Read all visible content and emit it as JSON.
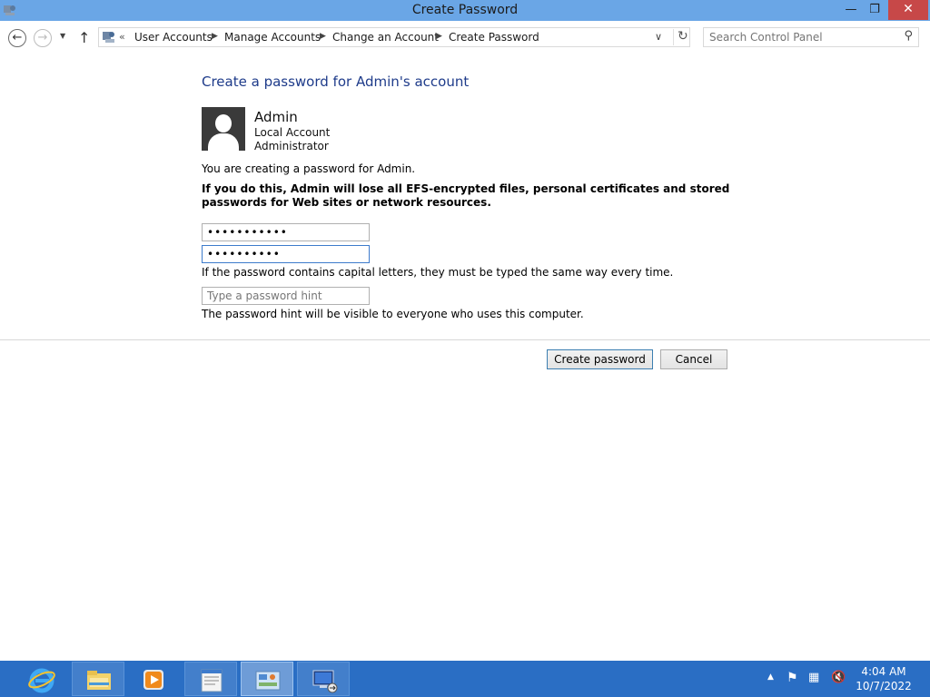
{
  "window": {
    "title": "Create Password",
    "minimize_glyph": "—",
    "maximize_glyph": "❐",
    "close_glyph": "✕"
  },
  "nav": {
    "back_glyph": "←",
    "forward_glyph": "→",
    "recent_glyph": "▼",
    "up_glyph": "↑",
    "overflow_glyph": "«",
    "breadcrumbs": [
      "User Accounts",
      "Manage Accounts",
      "Change an Account",
      "Create Password"
    ],
    "separator_glyph": "▶",
    "dropdown_glyph": "∨",
    "refresh_glyph": "↻",
    "search_placeholder": "Search Control Panel",
    "search_icon_glyph": "⚲"
  },
  "page": {
    "heading": "Create a password for Admin's account",
    "account": {
      "name": "Admin",
      "type": "Local Account",
      "role": "Administrator"
    },
    "intro": "You are creating a password for Admin.",
    "warning": "If you do this, Admin will lose all EFS-encrypted files, personal certificates and stored passwords for Web sites or network resources.",
    "new_password_value": "•••••••••••",
    "confirm_password_value": "••••••••••",
    "caps_note": "If the password contains capital letters, they must be typed the same way every time.",
    "hint_placeholder": "Type a password hint",
    "hint_note": "The password hint will be visible to everyone who uses this computer.",
    "create_button": "Create password",
    "cancel_button": "Cancel"
  },
  "taskbar": {
    "items": [
      {
        "icon": "internet-explorer-icon"
      },
      {
        "icon": "file-explorer-icon"
      },
      {
        "icon": "media-player-icon"
      },
      {
        "icon": "notepad-icon"
      },
      {
        "icon": "control-panel-icon",
        "active": true
      },
      {
        "icon": "remote-desktop-icon"
      }
    ],
    "tray": {
      "arrow_glyph": "▲",
      "flag_glyph": "⚑",
      "network_glyph": "▦",
      "volume_glyph": "🔇"
    },
    "clock": {
      "time": "4:04 AM",
      "date": "10/7/2022"
    }
  },
  "colors": {
    "titlebar": "#6aa6e6",
    "taskbar": "#2a6ec4",
    "heading": "#1e3b8a",
    "close_button": "#c74848"
  }
}
